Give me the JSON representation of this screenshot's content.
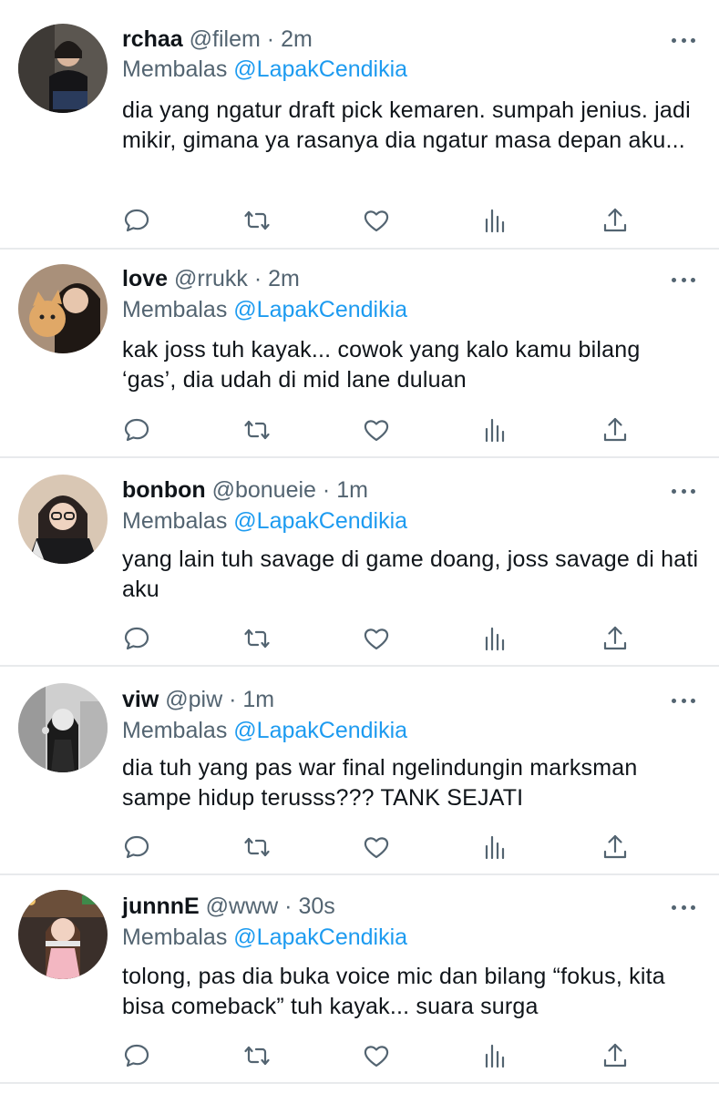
{
  "reply_prefix": "Membalas",
  "tweets": [
    {
      "name": "rchaa",
      "handle": "@filem",
      "time": "2m",
      "reply_to": "@LapakCendikia",
      "text": "dia yang ngatur draft pick kemaren. sumpah jenius. jadi mikir, gimana ya rasanya dia ngatur masa depan aku..."
    },
    {
      "name": "love",
      "handle": "@rrukk",
      "time": "2m",
      "reply_to": "@LapakCendikia",
      "text": "kak joss tuh kayak... cowok yang kalo kamu bilang ‘gas’, dia udah di mid lane duluan"
    },
    {
      "name": "bonbon",
      "handle": "@bonueie",
      "time": "1m",
      "reply_to": "@LapakCendikia",
      "text": "yang lain tuh savage di game doang, joss savage di hati aku"
    },
    {
      "name": "viw",
      "handle": "@piw",
      "time": "1m",
      "reply_to": "@LapakCendikia",
      "text": "dia tuh yang pas war final ngelindungin marksman sampe hidup terusss??? TANK SEJATI"
    },
    {
      "name": "junnnE",
      "handle": "@www",
      "time": "30s",
      "reply_to": "@LapakCendikia",
      "text": "tolong, pas dia buka voice mic dan bilang “fokus, kita bisa comeback” tuh kayak... suara surga"
    }
  ],
  "icons": {
    "reply": "reply-icon",
    "retweet": "retweet-icon",
    "like": "heart-icon",
    "views": "views-icon",
    "share": "share-icon",
    "more": "more-dots-icon"
  },
  "colors": {
    "link": "#1d9bf0",
    "secondary": "#536471",
    "text": "#0f1419",
    "divider": "#e8eaec"
  }
}
